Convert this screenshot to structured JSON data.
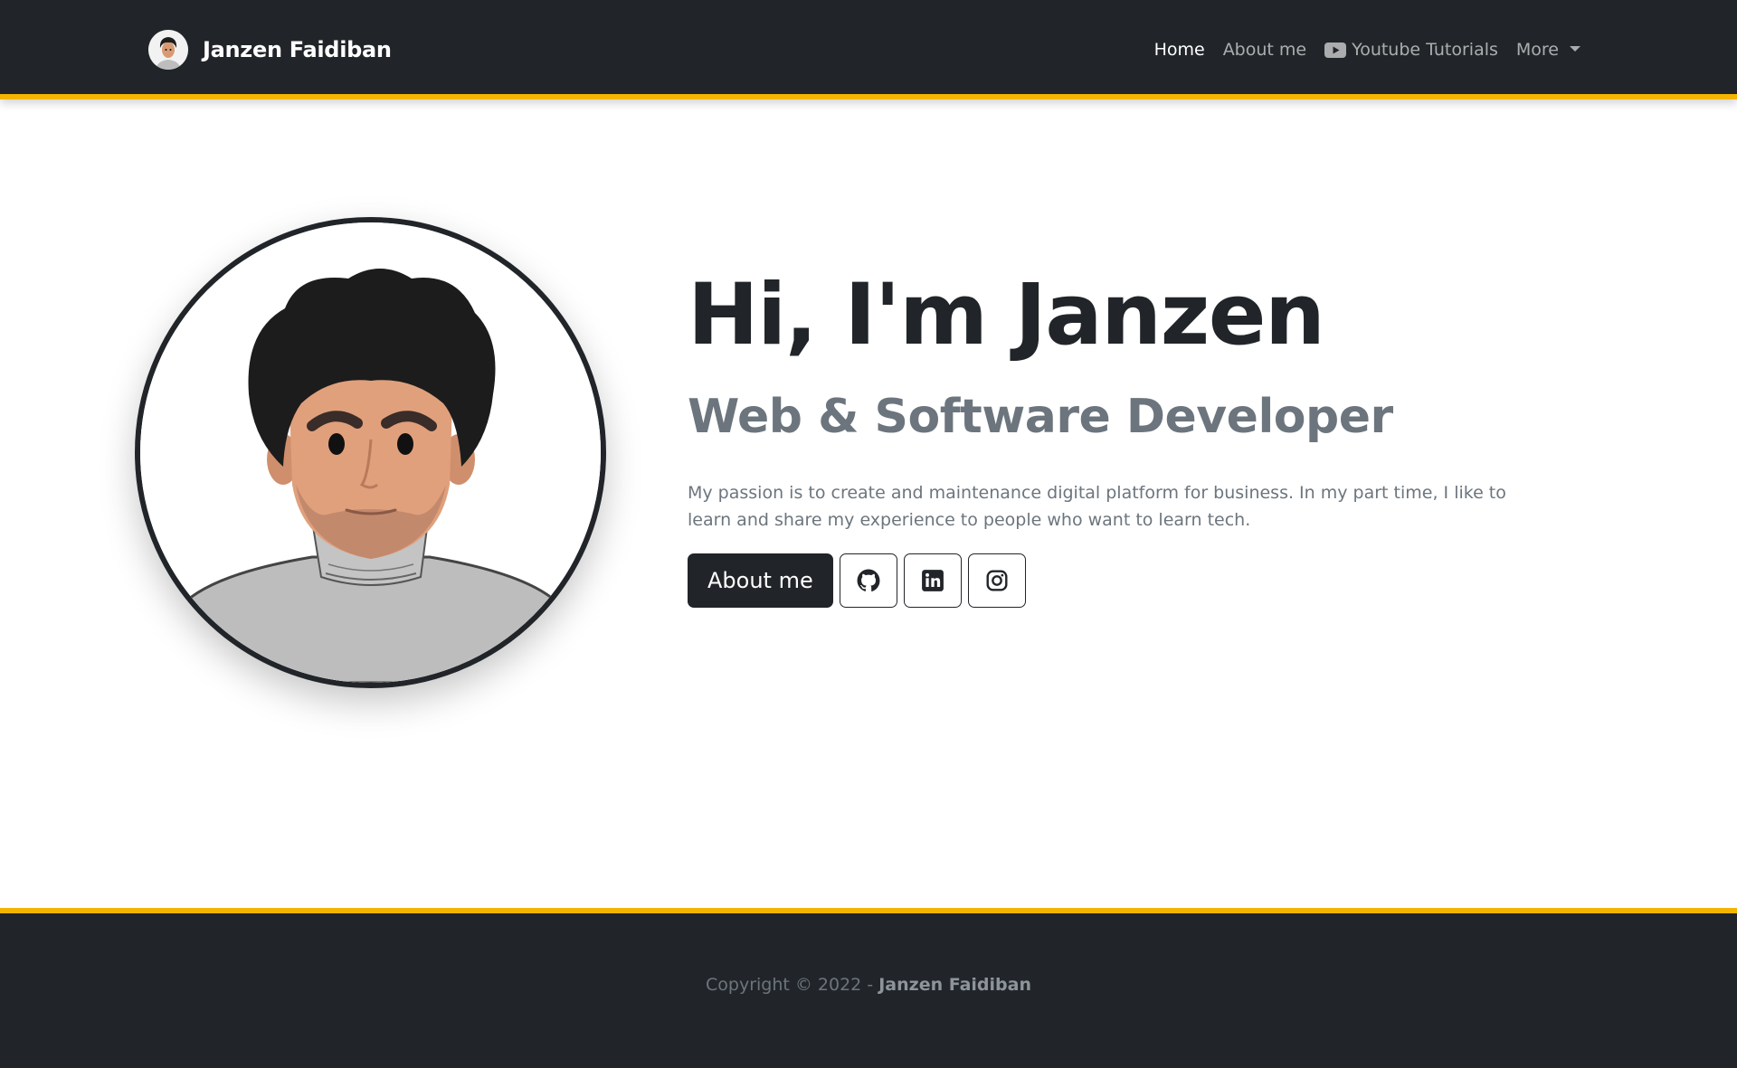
{
  "navbar": {
    "brand_name": "Janzen Faidiban",
    "brand_avatar_icon": "avatar-icon",
    "links": [
      {
        "label": "Home",
        "active": true
      },
      {
        "label": "About me",
        "active": false
      },
      {
        "label": "Youtube Tutorials",
        "active": false,
        "icon": "youtube-icon"
      },
      {
        "label": "More",
        "active": false,
        "icon": "caret-down-icon"
      }
    ]
  },
  "hero": {
    "title": "Hi, I'm Janzen",
    "subtitle": "Web & Software Developer",
    "description": "My passion is to create and maintenance digital platform for business. In my part time, I like to learn and share my experience to people who want to learn tech.",
    "primary_button": "About me",
    "social_icons": [
      "github-icon",
      "linkedin-icon",
      "instagram-icon"
    ]
  },
  "footer": {
    "copyright_prefix": "Copyright © 2022 - ",
    "owner": "Janzen Faidiban"
  },
  "colors": {
    "dark": "#212529",
    "accent": "#f4b400",
    "muted": "#6c757d"
  }
}
